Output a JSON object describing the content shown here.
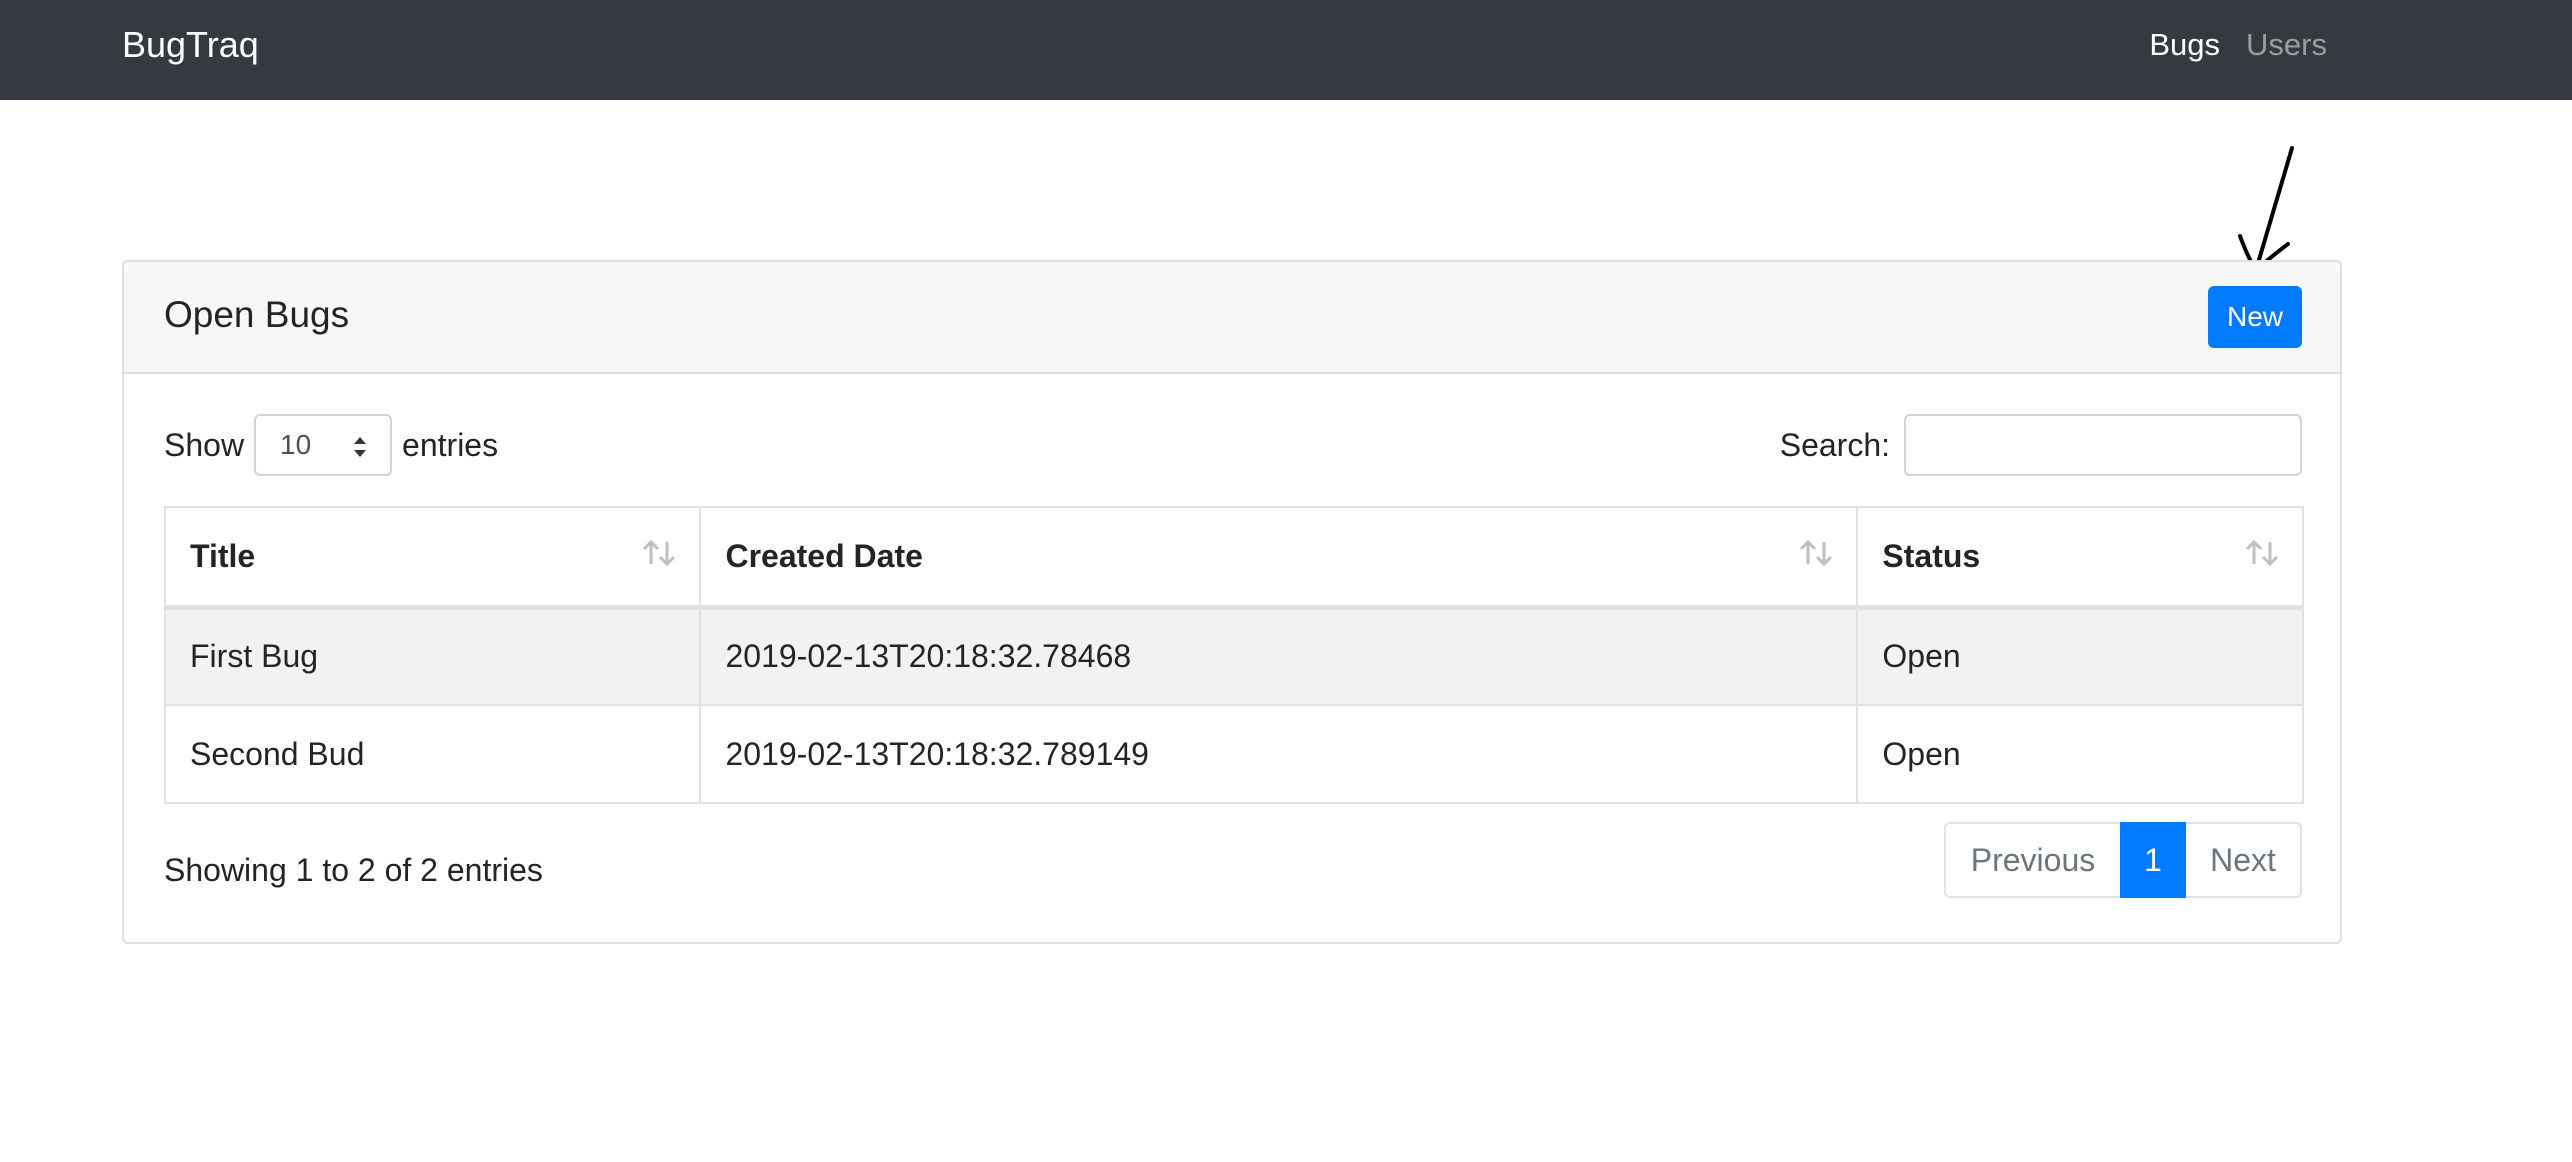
{
  "navbar": {
    "brand": "BugTraq",
    "links": [
      {
        "label": "Bugs",
        "active": true
      },
      {
        "label": "Users",
        "active": false
      }
    ]
  },
  "card": {
    "title": "Open Bugs",
    "new_button": "New"
  },
  "controls": {
    "show_label": "Show",
    "entries_value": "10",
    "entries_label": "entries",
    "search_label": "Search:",
    "search_value": "",
    "search_placeholder": ""
  },
  "table": {
    "columns": [
      "Title",
      "Created Date",
      "Status"
    ],
    "rows": [
      {
        "title": "First Bug",
        "created": "2019-02-13T20:18:32.78468",
        "status": "Open"
      },
      {
        "title": "Second Bud",
        "created": "2019-02-13T20:18:32.789149",
        "status": "Open"
      }
    ]
  },
  "footer": {
    "info": "Showing 1 to 2 of 2 entries",
    "pagination": {
      "previous": "Previous",
      "current_page": "1",
      "next": "Next"
    }
  },
  "colors": {
    "navbar_bg": "#343a40",
    "primary": "#007bff",
    "card_header_bg": "#f7f7f7",
    "striped_row_bg": "#f2f2f2"
  }
}
